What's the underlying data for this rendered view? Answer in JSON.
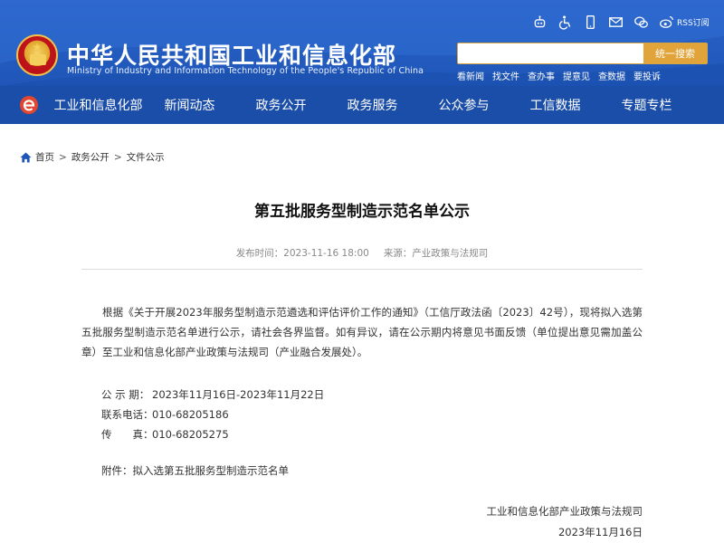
{
  "header": {
    "title": "中华人民共和国工业和信息化部",
    "subtitle": "Ministry of Industry and Information Technology of the People's Republic of China",
    "rss_label": "RSS订阅",
    "search": {
      "placeholder": "",
      "button_label": "统一搜索"
    },
    "quick_links": [
      "看新闻",
      "找文件",
      "查办事",
      "提意见",
      "查数据",
      "要投诉"
    ],
    "colors": {
      "header_blue": "#2a63c9",
      "nav_blue": "#1b4ea8",
      "search_button": "#e1a43a"
    }
  },
  "nav": {
    "items": [
      "工业和信息化部",
      "新闻动态",
      "政务公开",
      "政务服务",
      "公众参与",
      "工信数据",
      "专题专栏"
    ]
  },
  "breadcrumb": [
    "首页",
    "政务公开",
    "文件公示"
  ],
  "article": {
    "title": "第五批服务型制造示范名单公示",
    "publish_label": "发布时间：2023-11-16 18:00",
    "source_label": "来源：产业政策与法规司",
    "body": "根据《关于开展2023年服务型制造示范遴选和评估评价工作的通知》（工信厅政法函〔2023〕42号），现将拟入选第五批服务型制造示范名单进行公示，请社会各界监督。如有异议，请在公示期内将意见书面反馈（单位提出意见需加盖公章）至工业和信息化部产业政策与法规司（产业融合发展处）。",
    "info": [
      {
        "label": "公 示 期：",
        "value": "2023年11月16日-2023年11月22日"
      },
      {
        "label": "联系电话：",
        "value": "010-68205186"
      },
      {
        "label": "传　　真：",
        "value": "010-68205275"
      }
    ],
    "attachment_prefix": "附件：",
    "attachment_name": "拟入选第五批服务型制造示范名单",
    "sign_org": "工业和信息化部产业政策与法规司",
    "sign_date": "2023年11月16日"
  }
}
